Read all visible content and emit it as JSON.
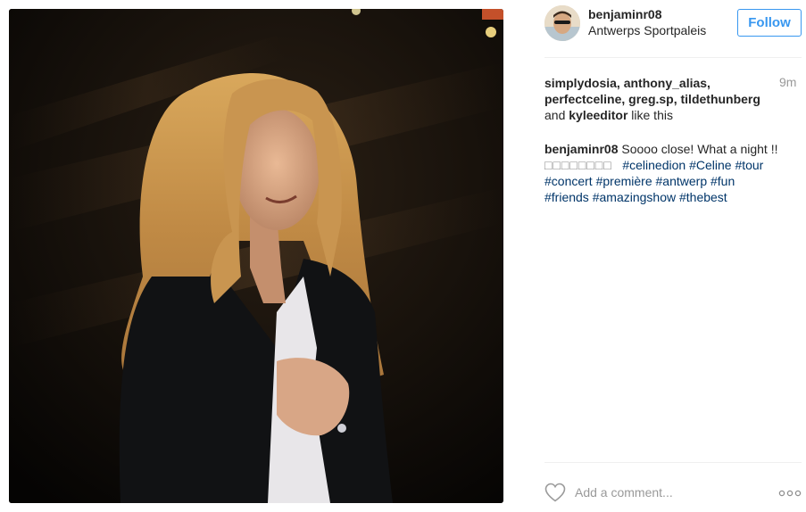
{
  "header": {
    "username": "benjaminr08",
    "location": "Antwerps Sportpaleis",
    "follow_label": "Follow"
  },
  "likes": {
    "names_line1": "simplydosia, anthony_alias,",
    "names_line2": "perfectceline, greg.sp, tildethunberg",
    "and_word": "and",
    "last_name": "kyleeditor",
    "suffix": "like this",
    "time": "9m"
  },
  "caption": {
    "user": "benjaminr08",
    "text": "Soooo close! What a night !!",
    "emoji_boxes": "□□□□□□□□",
    "hashtags": [
      "#celinedion",
      "#Celine",
      "#tour",
      "#concert",
      "#première",
      "#antwerp",
      "#fun",
      "#friends",
      "#amazingshow",
      "#thebest"
    ]
  },
  "comment": {
    "placeholder": "Add a comment..."
  },
  "colors": {
    "link_blue": "#3897f0",
    "hashtag": "#003569",
    "muted": "#999999"
  },
  "icons": {
    "like": "heart-icon",
    "options": "more-options-icon",
    "avatar": "avatar"
  }
}
